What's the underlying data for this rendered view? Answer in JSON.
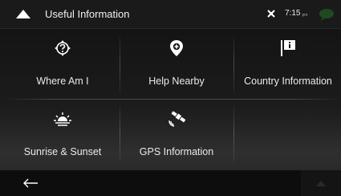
{
  "header": {
    "title": "Useful Information",
    "time": "7:15",
    "time_suffix": "pm",
    "back_icon": "chevron-up-icon",
    "gps_icon": "gps-satellite-icon",
    "message_icon": "chat-bubble-icon"
  },
  "tiles": [
    {
      "label": "Where Am I",
      "icon": "question-location-icon"
    },
    {
      "label": "Help Nearby",
      "icon": "help-pin-icon"
    },
    {
      "label": "Country Information",
      "icon": "info-flag-icon"
    },
    {
      "label": "Sunrise & Sunset",
      "icon": "sunrise-icon"
    },
    {
      "label": "GPS Information",
      "icon": "satellite-icon"
    }
  ],
  "footer": {
    "back_icon": "arrow-left-icon",
    "up_icon": "chevron-up-icon"
  },
  "colors": {
    "background": "#1a1a1a",
    "text": "#eaeaea",
    "status_gps": "#ffffff",
    "message_icon": "#1f4a1f"
  }
}
